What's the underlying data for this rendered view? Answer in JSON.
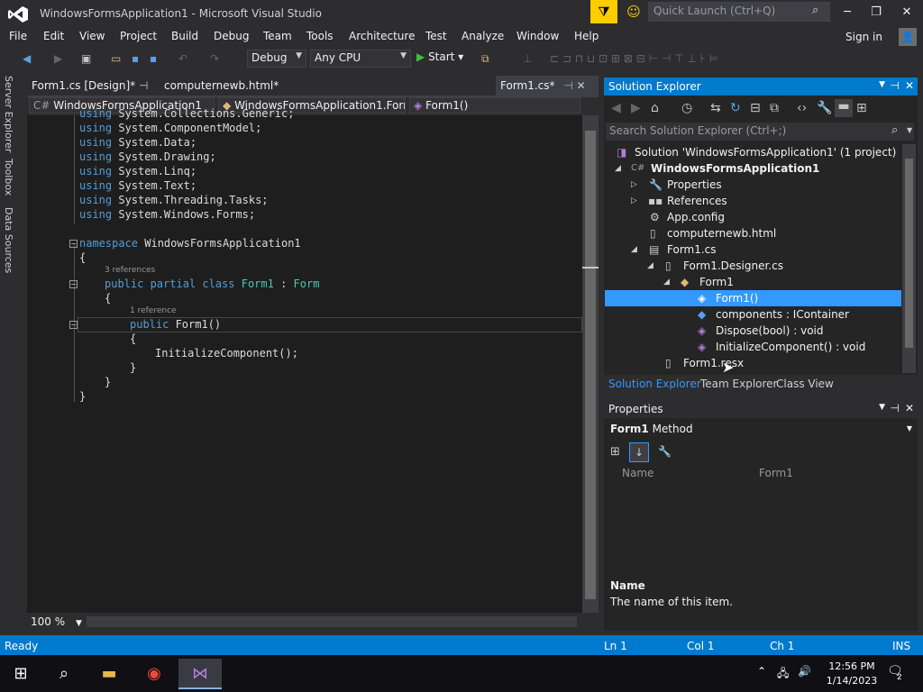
{
  "window": {
    "title": "WindowsFormsApplication1 - Microsoft Visual Studio"
  },
  "quicklaunch": {
    "placeholder": "Quick Launch (Ctrl+Q)"
  },
  "menu": {
    "items": [
      "File",
      "Edit",
      "View",
      "Project",
      "Build",
      "Debug",
      "Team",
      "Tools",
      "Architecture",
      "Test",
      "Analyze",
      "Window",
      "Help"
    ],
    "signin": "Sign in"
  },
  "toolbar": {
    "config": "Debug",
    "platform": "Any CPU",
    "start": "Start"
  },
  "leftrail": {
    "tabs": [
      "Server Explorer",
      "Toolbox",
      "Data Sources"
    ]
  },
  "doctabs": [
    {
      "label": "Form1.cs [Design]*"
    },
    {
      "label": "computernewb.html*"
    },
    {
      "label": "Form1.cs*"
    }
  ],
  "navbar": {
    "project": "WindowsFormsApplication1",
    "class": "WindowsFormsApplication1.Forr",
    "member": "Form1()"
  },
  "code": {
    "lines": [
      [
        "using ",
        "System.Collections.Generic;"
      ],
      [
        "using ",
        "System.ComponentModel;"
      ],
      [
        "using ",
        "System.Data;"
      ],
      [
        "using ",
        "System.Drawing;"
      ],
      [
        "using ",
        "System.Linq;"
      ],
      [
        "using ",
        "System.Text;"
      ],
      [
        "using ",
        "System.Threading.Tasks;"
      ],
      [
        "using ",
        "System.Windows.Forms;"
      ]
    ],
    "ns_kw": "namespace",
    "ns_name": " WindowsFormsApplication1",
    "brace_open": "{",
    "brace_close": "}",
    "lens1": "3 references",
    "class_decl": {
      "kw": "public partial class ",
      "name": "Form1",
      "sep": " : ",
      "base": "Form"
    },
    "lens2": "1 reference",
    "ctor_kw": "public ",
    "ctor_name": "Form1()",
    "init_call": "InitializeComponent();"
  },
  "editor": {
    "zoom": "100 %"
  },
  "solution_explorer": {
    "title": "Solution Explorer",
    "search_placeholder": "Search Solution Explorer (Ctrl+;)",
    "nodes": [
      "Solution 'WindowsFormsApplication1' (1 project)",
      "WindowsFormsApplication1",
      "Properties",
      "References",
      "App.config",
      "computernewb.html",
      "Form1.cs",
      "Form1.Designer.cs",
      "Form1",
      "Form1()",
      "components : IContainer",
      "Dispose(bool) : void",
      "InitializeComponent() : void",
      "Form1.resx"
    ],
    "tabs": [
      "Solution Explorer",
      "Team Explorer",
      "Class View"
    ]
  },
  "properties": {
    "title": "Properties",
    "object_name": "Form1",
    "object_type": "Method",
    "grid_name_label": "Name",
    "grid_name_value": "Form1",
    "desc_title": "Name",
    "desc_text": "The name of this item."
  },
  "status": {
    "ready": "Ready",
    "ln": "Ln 1",
    "col": "Col 1",
    "ch": "Ch 1",
    "ins": "INS"
  },
  "taskbar": {
    "time": "12:56 PM",
    "date": "1/14/2023",
    "notifications": "2"
  },
  "colors": {
    "accent": "#007acc",
    "selection": "#3399ff",
    "keyword": "#569cd6",
    "type": "#4ec9b0"
  }
}
